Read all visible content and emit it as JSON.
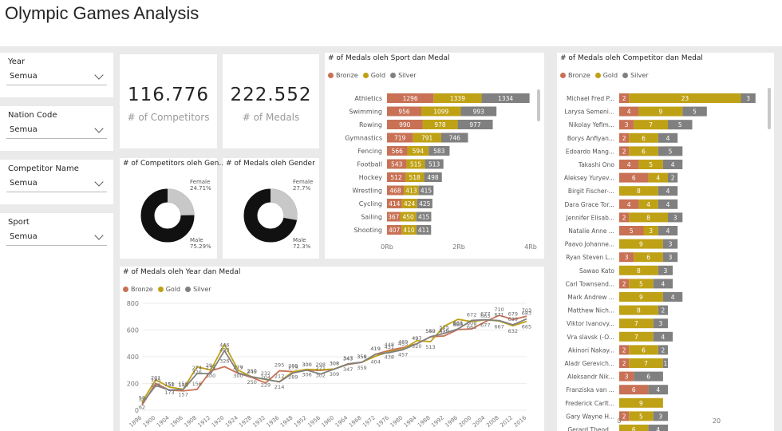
{
  "page": {
    "title": "Olympic Games Analysis"
  },
  "colors": {
    "bronze": "#C87155",
    "gold": "#BFA115",
    "silver": "#808080",
    "donut_dark": "#111111",
    "donut_light": "#C8C8C8"
  },
  "slicers": [
    {
      "label": "Year",
      "value": "Semua"
    },
    {
      "label": "Nation Code",
      "value": "Semua"
    },
    {
      "label": "Competitor Name",
      "value": "Semua"
    },
    {
      "label": "Sport",
      "value": "Semua"
    }
  ],
  "kpis": [
    {
      "value": "116.776",
      "label": "# of Competitors"
    },
    {
      "value": "222.552",
      "label": "# of Medals"
    }
  ],
  "legend": [
    "Bronze",
    "Gold",
    "Silver"
  ],
  "chart_data": [
    {
      "type": "pie",
      "title": "# of Competitors oleh Gen...",
      "slices": [
        {
          "name": "Female",
          "label": "24.71%",
          "value": 24.71
        },
        {
          "name": "Male",
          "label": "75.29%",
          "value": 75.29
        }
      ]
    },
    {
      "type": "pie",
      "title": "# of Medals oleh Gender",
      "slices": [
        {
          "name": "Female",
          "label": "27.7%",
          "value": 27.7
        },
        {
          "name": "Male",
          "label": "72.3%",
          "value": 72.3
        }
      ]
    },
    {
      "type": "bar",
      "title": "# of Medals oleh Sport dan Medal",
      "categories": [
        "Athletics",
        "Swimming",
        "Rowing",
        "Gymnastics",
        "Fencing",
        "Football",
        "Hockey",
        "Wrestling",
        "Cycling",
        "Sailing",
        "Shooting"
      ],
      "series": [
        {
          "name": "Bronze",
          "values": [
            1296,
            956,
            990,
            719,
            566,
            543,
            512,
            468,
            414,
            367,
            407
          ]
        },
        {
          "name": "Gold",
          "values": [
            1339,
            1099,
            978,
            791,
            594,
            515,
            518,
            413,
            424,
            450,
            410
          ]
        },
        {
          "name": "Silver",
          "values": [
            1334,
            993,
            977,
            746,
            583,
            513,
            498,
            415,
            425,
            415,
            411
          ]
        }
      ],
      "xticks": [
        "0Rb",
        "2Rb",
        "4Rb"
      ],
      "xlim": [
        0,
        4000
      ]
    },
    {
      "type": "bar",
      "title": "# of Medals oleh Competitor dan Medal",
      "categories": [
        "Michael Fred P...",
        "Larysa Semeni...",
        "Nikolay Yefim...",
        "Borys Anfiyan...",
        "Edoardo Mang...",
        "Takashi Ono",
        "Aleksey Yuryev...",
        "Birgit Fischer-...",
        "Dara Grace Tor...",
        "Jennifer Elisab...",
        "Natalie Anne ...",
        "Paavo Johanne...",
        "Ryan Steven L...",
        "Sawao Kato",
        "Carl Townsend...",
        "Mark Andrew ...",
        "Matthew Nich...",
        "Viktor Ivanovy...",
        "Vra slavsk (-O...",
        "Akinori Nakay...",
        "Aladr Gerevich...",
        "Aleksandr Nik...",
        "Franziska van ...",
        "Frederick Carlt...",
        "Gary Wayne H...",
        "Gerard Theod..."
      ],
      "series": [
        {
          "name": "Bronze",
          "values": [
            2,
            4,
            3,
            2,
            2,
            4,
            6,
            0,
            4,
            2,
            5,
            0,
            3,
            0,
            2,
            0,
            0,
            0,
            0,
            2,
            2,
            3,
            6,
            0,
            2,
            0
          ]
        },
        {
          "name": "Gold",
          "values": [
            23,
            9,
            7,
            6,
            6,
            5,
            4,
            8,
            4,
            8,
            3,
            9,
            6,
            8,
            5,
            9,
            8,
            7,
            7,
            6,
            7,
            0,
            0,
            9,
            5,
            6
          ]
        },
        {
          "name": "Silver",
          "values": [
            3,
            5,
            5,
            4,
            5,
            4,
            2,
            4,
            4,
            3,
            4,
            3,
            3,
            3,
            4,
            4,
            2,
            3,
            4,
            2,
            1,
            6,
            4,
            0,
            3,
            4
          ]
        }
      ],
      "xticks": [
        "0",
        "20"
      ],
      "xlim": [
        0,
        30
      ]
    },
    {
      "type": "line",
      "title": "# of Medals oleh Year dan Medal",
      "x": [
        "1896",
        "1900",
        "1904",
        "1906",
        "1908",
        "1912",
        "1920",
        "1924",
        "1928",
        "1932",
        "1936",
        "1948",
        "1952",
        "1956",
        "1960",
        "1964",
        "1968",
        "1972",
        "1976",
        "1980",
        "1984",
        "1988",
        "1992",
        "1996",
        "2000",
        "2004",
        "2008",
        "2012",
        "2016"
      ],
      "series": [
        {
          "name": "Bronze",
          "values": [
            38,
            201,
            150,
            145,
            156,
            294,
            326,
            277,
            245,
            204,
            295,
            289,
            300,
            298,
            308,
            343,
            358,
            419,
            448,
            469,
            497,
            549,
            556,
            604,
            608,
            663,
            710,
            679,
            703
          ]
        },
        {
          "name": "Gold",
          "values": [
            62,
            228,
            173,
            157,
            326,
            300,
            493,
            300,
            250,
            229,
            214,
            289,
            306,
            302,
            309,
            347,
            359,
            404,
            438,
            457,
            520,
            513,
            629,
            680,
            663,
            677,
            667,
            632,
            665
          ]
        },
        {
          "name": "Silver",
          "values": [
            50,
            185,
            151,
            156,
            274,
            275,
            446,
            279,
            250,
            232,
            212,
            279,
            300,
            271,
            308,
            347,
            359,
            419,
            431,
            453,
            497,
            550,
            575,
            608,
            672,
            677,
            671,
            639,
            683
          ]
        }
      ],
      "xticks": [
        "1896",
        "1900",
        "1904",
        "1906",
        "1908",
        "1912",
        "1920",
        "1924",
        "1928",
        "1932",
        "1936",
        "1948",
        "1952",
        "1956",
        "1960",
        "1964",
        "1968",
        "1972",
        "1976",
        "1980",
        "1984",
        "1988",
        "1992",
        "1996",
        "2000",
        "2004",
        "2008",
        "2012",
        "2016"
      ],
      "yticks": [
        "0",
        "200",
        "400",
        "600",
        "800"
      ],
      "ylim": [
        0,
        800
      ]
    }
  ]
}
